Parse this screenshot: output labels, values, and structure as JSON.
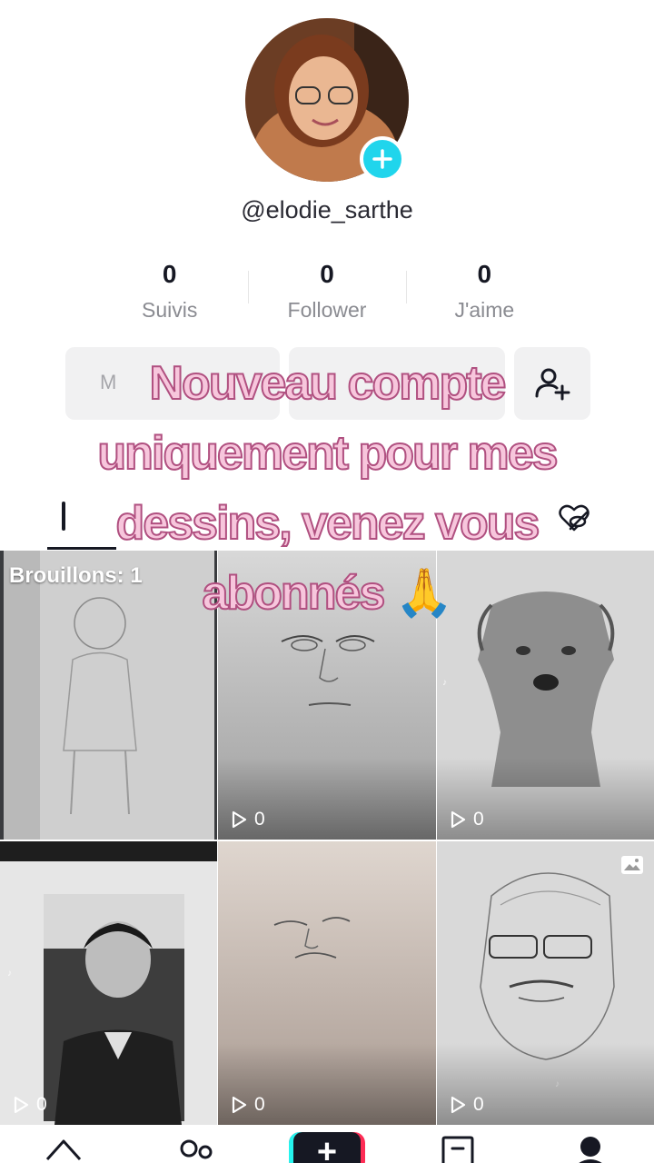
{
  "profile": {
    "username": "@elodie_sarthe"
  },
  "stats": [
    {
      "value": "0",
      "label": "Suivis"
    },
    {
      "value": "0",
      "label": "Follower"
    },
    {
      "value": "0",
      "label": "J'aime"
    }
  ],
  "buttons": {
    "edit_label": "M",
    "share_label": ""
  },
  "overlay": {
    "line1": "Nouveau compte",
    "line2": "uniquement pour mes",
    "line3": "dessins,  venez vous",
    "line4": "abonnés",
    "emoji": "🙏"
  },
  "videos": [
    {
      "overlay_label": "Brouillons: 1",
      "views": ""
    },
    {
      "views": "0"
    },
    {
      "views": "0"
    },
    {
      "views": "0"
    },
    {
      "views": "0"
    },
    {
      "views": "0"
    }
  ],
  "bottom_nav": {
    "create_symbol": "+"
  },
  "colors": {
    "accent_cyan": "#20d5ec",
    "tiktok_red": "#fe2c55",
    "tiktok_cyan": "#25f4ee",
    "caption_fill": "#f7c6dc",
    "caption_stroke": "#b05080"
  }
}
